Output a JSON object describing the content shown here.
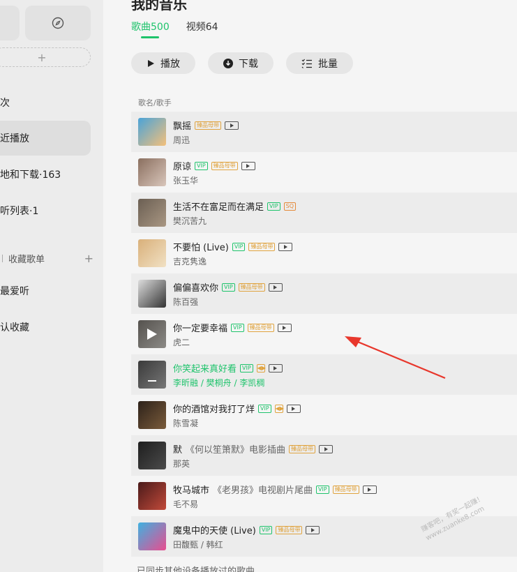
{
  "top_title_cut": "我的音乐",
  "tabs": [
    {
      "label": "歌曲500",
      "active": true
    },
    {
      "label": "视频64",
      "active": false
    }
  ],
  "actions": {
    "play": "播放",
    "download": "下载",
    "batch": "批量"
  },
  "sidebar": {
    "items": [
      {
        "label": "次",
        "active": false
      },
      {
        "label": "近播放",
        "active": true
      },
      {
        "label": "地和下载·163",
        "active": false
      },
      {
        "label": "听列表·1",
        "active": false
      }
    ],
    "section_label": "收藏歌单",
    "playlists": [
      {
        "label": "最爱听"
      },
      {
        "label": "认收藏"
      }
    ]
  },
  "list_header": "歌名/歌手",
  "songs": [
    {
      "title": "飘摇",
      "artist": "周迅",
      "badges": [
        "hq"
      ],
      "mv": true
    },
    {
      "title": "原谅",
      "artist": "张玉华",
      "badges": [
        "vip",
        "hq"
      ],
      "mv": true
    },
    {
      "title": "生活不在富足而在满足",
      "artist": "樊沉苦九",
      "badges": [
        "vip",
        "sq"
      ],
      "mv": false
    },
    {
      "title": "不要怕 (Live)",
      "artist": "吉克隽逸",
      "badges": [
        "vip",
        "hq"
      ],
      "mv": true
    },
    {
      "title": "偏偏喜欢你",
      "artist": "陈百强",
      "badges": [
        "vip",
        "hq"
      ],
      "mv": true
    },
    {
      "title": "你一定要幸福",
      "artist": "虎二",
      "badges": [
        "vip",
        "hq"
      ],
      "mv": true
    },
    {
      "title": "你笑起来真好看",
      "artist": "李昕融 / 樊桐舟 / 李凯稠",
      "badges": [
        "vip",
        "dolby"
      ],
      "mv": true
    },
    {
      "title": "你的酒馆对我打了烊",
      "artist": "陈雪凝",
      "badges": [
        "vip",
        "dolby"
      ],
      "mv": true
    },
    {
      "title": "默",
      "subtitle": "《何以笙箫默》电影插曲",
      "artist": "那英",
      "badges": [
        "hq"
      ],
      "mv": true
    },
    {
      "title": "牧马城市",
      "subtitle": "《老男孩》电视剧片尾曲",
      "artist": "毛不易",
      "badges": [
        "vip",
        "hq"
      ],
      "mv": true
    },
    {
      "title": "魔鬼中的天使 (Live)",
      "artist": "田馥甄 / 韩红",
      "badges": [
        "vip",
        "hq"
      ],
      "mv": true
    }
  ],
  "badge_labels": {
    "vip": "VIP",
    "hq": "臻品母带",
    "sq": "SQ",
    "dolby": "◀▶"
  },
  "footer": "已同步其他设备播放过的歌曲",
  "watermark": "赚客吧，有奖一起赚！www.zuanke8.com",
  "colors": {
    "accent": "#1ec36b",
    "arrow": "#e8372c"
  }
}
